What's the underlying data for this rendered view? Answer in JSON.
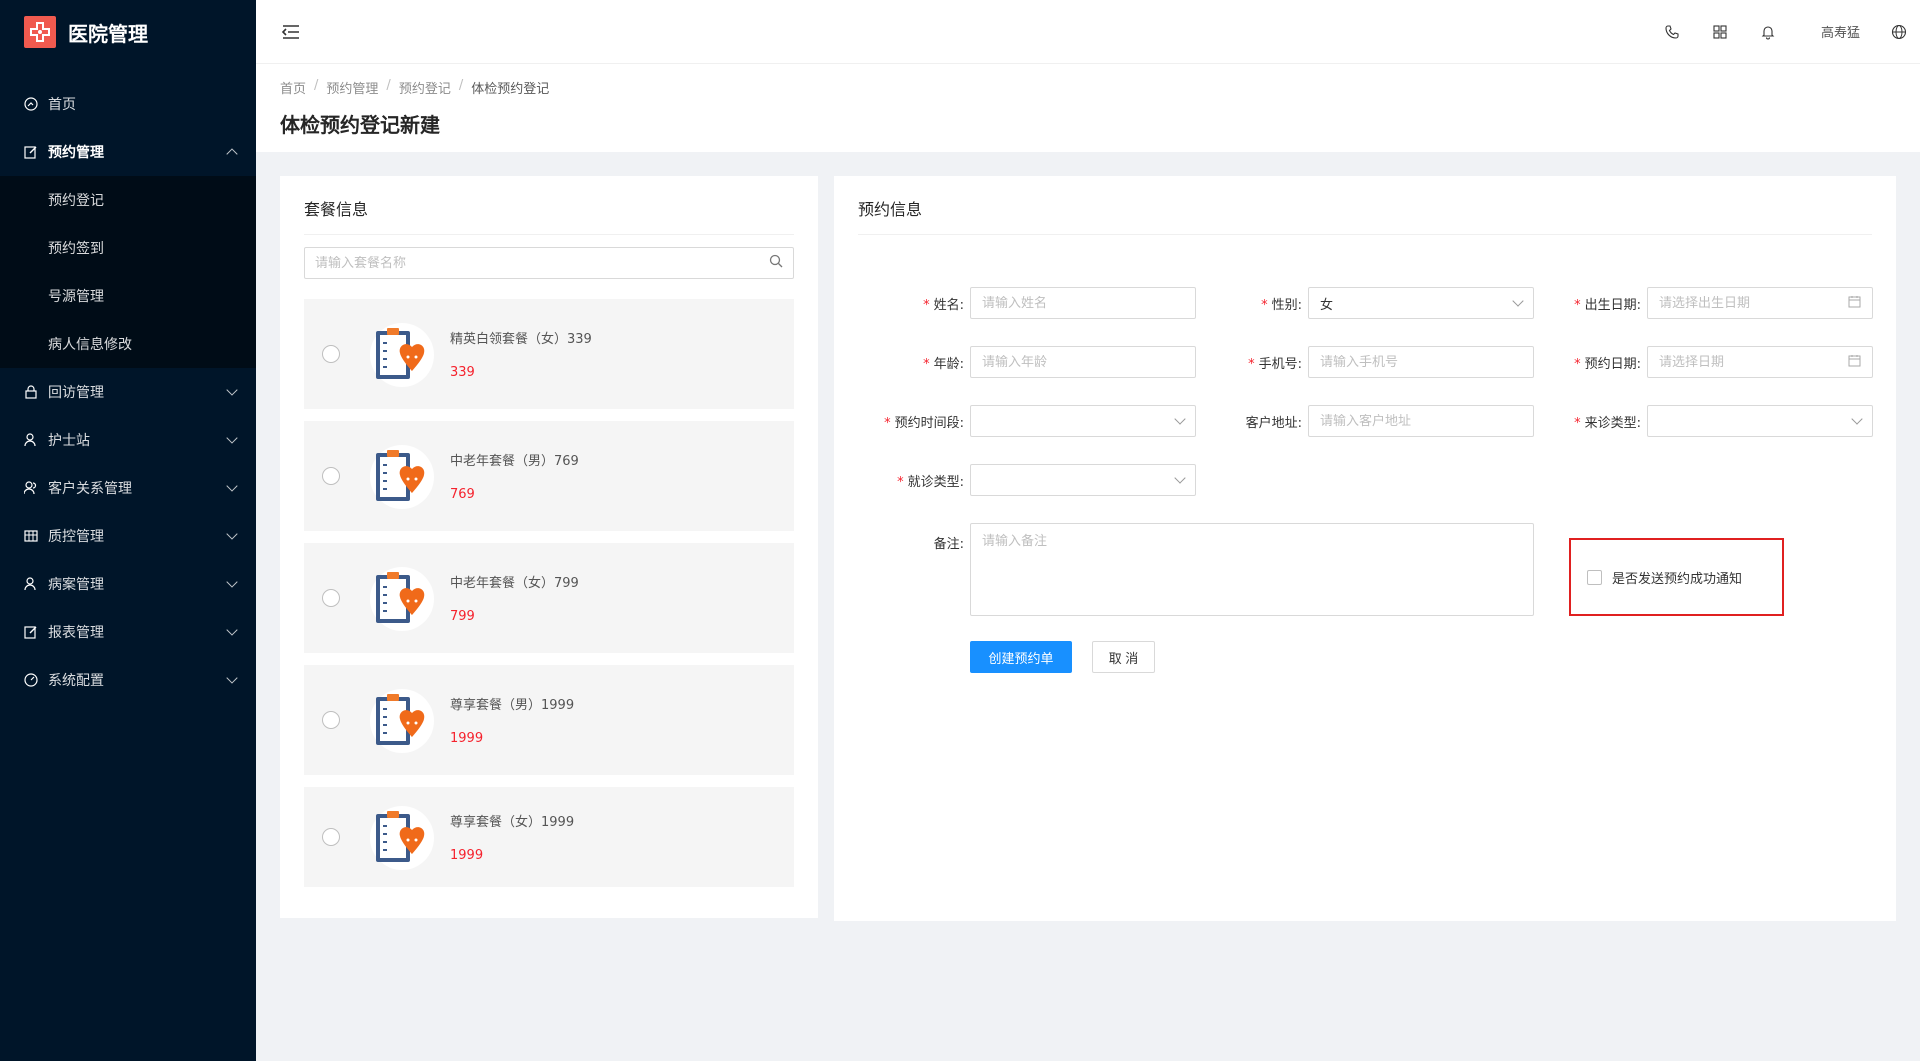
{
  "app": {
    "title": "医院管理",
    "logo_icon": "hospital-cross-icon",
    "brand_color": "#f05a4f"
  },
  "sidebar": {
    "items": [
      {
        "label": "首页",
        "icon": "dashboard-icon"
      },
      {
        "label": "预约管理",
        "icon": "edit-icon",
        "open": true,
        "children": [
          {
            "label": "预约登记"
          },
          {
            "label": "预约签到"
          },
          {
            "label": "号源管理"
          },
          {
            "label": "病人信息修改"
          }
        ]
      },
      {
        "label": "回访管理",
        "icon": "lock-icon"
      },
      {
        "label": "护士站",
        "icon": "user-icon"
      },
      {
        "label": "客户关系管理",
        "icon": "users-icon"
      },
      {
        "label": "质控管理",
        "icon": "table-icon"
      },
      {
        "label": "病案管理",
        "icon": "user-icon"
      },
      {
        "label": "报表管理",
        "icon": "edit-icon"
      },
      {
        "label": "系统配置",
        "icon": "dashboard-icon"
      }
    ]
  },
  "header": {
    "username": "高寿猛",
    "icons": [
      "phone-icon",
      "apps-icon",
      "bell-icon",
      "globe-icon"
    ]
  },
  "breadcrumb": {
    "items": [
      "首页",
      "预约管理",
      "预约登记",
      "体检预约登记"
    ]
  },
  "page_title": "体检预约登记新建",
  "package_card": {
    "title": "套餐信息",
    "search_placeholder": "请输入套餐名称",
    "packages": [
      {
        "name": "精英白领套餐（女）339",
        "price": "339"
      },
      {
        "name": "中老年套餐（男）769",
        "price": "769"
      },
      {
        "name": "中老年套餐（女）799",
        "price": "799"
      },
      {
        "name": "尊享套餐（男）1999",
        "price": "1999"
      },
      {
        "name": "尊享套餐（女）1999",
        "price": "1999"
      }
    ]
  },
  "booking_card": {
    "title": "预约信息",
    "fields": {
      "name": {
        "label": "姓名:",
        "placeholder": "请输入姓名"
      },
      "gender": {
        "label": "性别:",
        "value": "女"
      },
      "birth": {
        "label": "出生日期:",
        "placeholder": "请选择出生日期"
      },
      "age": {
        "label": "年龄:",
        "placeholder": "请输入年龄"
      },
      "phone": {
        "label": "手机号:",
        "placeholder": "请输入手机号"
      },
      "date": {
        "label": "预约日期:",
        "placeholder": "请选择日期"
      },
      "timeslot": {
        "label": "预约时间段:"
      },
      "address": {
        "label": "客户地址:",
        "placeholder": "请输入客户地址"
      },
      "visit_type": {
        "label": "来诊类型:"
      },
      "clinic_type": {
        "label": "就诊类型:"
      },
      "remark": {
        "label": "备注:",
        "placeholder": "请输入备注"
      }
    },
    "notify_label": "是否发送预约成功通知",
    "submit_label": "创建预约单",
    "cancel_label": "取 消"
  }
}
